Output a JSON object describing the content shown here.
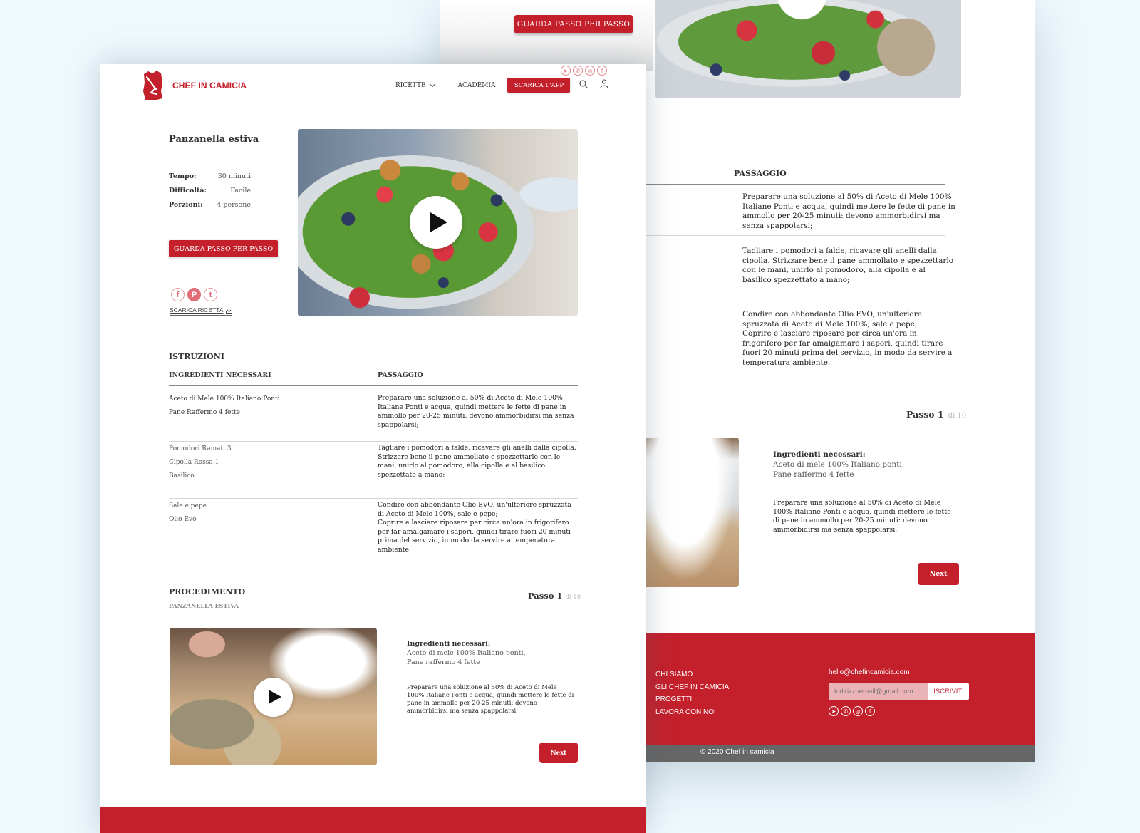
{
  "brand": {
    "name": "CHEF IN CAMICIA",
    "accent_color": "#c4202c"
  },
  "header": {
    "social_icons": [
      "telegram-icon",
      "whatsapp-icon",
      "instagram-icon",
      "facebook-icon"
    ],
    "social_glyphs": [
      "➤",
      "✆",
      "◎",
      "f"
    ],
    "nav": {
      "ricette": "RICETTE",
      "accademia": "ACADÈMIA",
      "app_button": "SCARICA L'APP"
    }
  },
  "recipe": {
    "title": "Panzanella estiva",
    "meta": [
      {
        "label": "Tempo:",
        "value": "30 minuti"
      },
      {
        "label": "Difficoltà:",
        "value": "Facile"
      },
      {
        "label": "Porzioni:",
        "value": "4 persone"
      }
    ],
    "watch_button": "GUARDA PASSO PER PASSO",
    "share_glyphs": [
      "f",
      "P",
      "t"
    ],
    "download_label": "SCARICA RICETTA"
  },
  "instructions": {
    "title": "ISTRUZIONI",
    "col_ingredients": "INGREDIENTI NECESSARI",
    "col_step": "PASSAGGIO",
    "rows": [
      {
        "ingredients": [
          "Aceto di Mele 100% Italiano Ponti",
          "Pane Raffermo 4 fette"
        ],
        "step": "Preparare una soluzione al 50% di Aceto di Mele 100% Italiane Ponti e acqua, quindi mettere le fette di pane in ammollo per 20-25 minuti: devono ammorbidirsi ma senza spappolarsi;"
      },
      {
        "ingredients": [
          "Pomodori Ramati 3",
          "Cipolla Rossa 1",
          "Basilico"
        ],
        "step": "Tagliare i pomodori a falde, ricavare gli anelli dalla cipolla. Strizzare bene il pane ammollato e spezzettarlo con le mani, unirlo al pomodoro, alla cipolla e al basilico spezzettato a mano;"
      },
      {
        "ingredients": [
          "Sale e pepe",
          "Olio Evo"
        ],
        "step": "Condire con abbondante Olio EVO, un'ulteriore spruzzata di Aceto di Mele 100%, sale e pepe;\nCoprire e lasciare riposare per circa un'ora in frigorifero per far amalgamare i sapori, quindi tirare fuori 20 minuti prima del servizio, in modo da servire a temperatura ambiente."
      }
    ]
  },
  "procedure": {
    "title": "PROCEDIMENTO",
    "subtitle": "PANZANELLA ESTIVA",
    "step_label": "Passo 1",
    "step_total": "di 10",
    "ingredients_heading": "Ingredienti necessari:",
    "ingredients_line1": "Aceto di mele 100% Italiano ponti,",
    "ingredients_line2": "Pane raffermo 4 fette",
    "description": "Preparare una soluzione al 50% di Aceto di Mele 100% Italiane Ponti e acqua, quindi mettere le fette di pane in ammollo per 20-25 minuti: devono ammorbidirsi ma senza spappolarsi;",
    "next_button": "Next"
  },
  "footer": {
    "links": [
      "CHI SIAMO",
      "GLI CHEF IN CAMICIA",
      "PROGETTI",
      "LAVORA CON NOI"
    ],
    "email": "hello@chefincamicia.com",
    "subscribe_placeholder": "indirizzoemail@gmail.com",
    "subscribe_button": "ISCRIVITI",
    "copyright": "©  2020 Chef in camicia"
  }
}
